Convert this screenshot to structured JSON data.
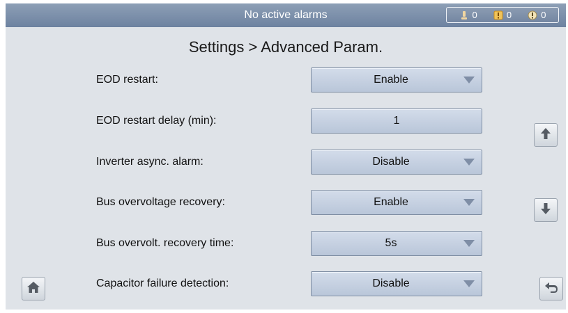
{
  "status_bar": {
    "alarm_text": "No active alarms",
    "counts": [
      {
        "icon": "minor-alarm-icon",
        "value": "0"
      },
      {
        "icon": "major-alarm-icon",
        "value": "0"
      },
      {
        "icon": "critical-alarm-icon",
        "value": "0"
      }
    ]
  },
  "page": {
    "title": "Settings > Advanced Param."
  },
  "params": [
    {
      "label": "EOD restart:",
      "value": "Enable",
      "type": "dropdown"
    },
    {
      "label": "EOD restart delay (min):",
      "value": "1",
      "type": "input"
    },
    {
      "label": "Inverter async. alarm:",
      "value": "Disable",
      "type": "dropdown"
    },
    {
      "label": "Bus overvoltage recovery:",
      "value": "Enable",
      "type": "dropdown"
    },
    {
      "label": "Bus overvolt. recovery time:",
      "value": "5s",
      "type": "dropdown"
    },
    {
      "label": "Capacitor failure detection:",
      "value": "Disable",
      "type": "dropdown"
    }
  ],
  "nav": {
    "scroll_up_icon": "arrow-up-icon",
    "scroll_down_icon": "arrow-down-icon",
    "home_icon": "home-icon",
    "back_icon": "back-arrow-icon"
  },
  "colors": {
    "status_bar": "#7a8eaa",
    "field_fill": "#c6d1e2",
    "background": "#dfe3e8"
  }
}
